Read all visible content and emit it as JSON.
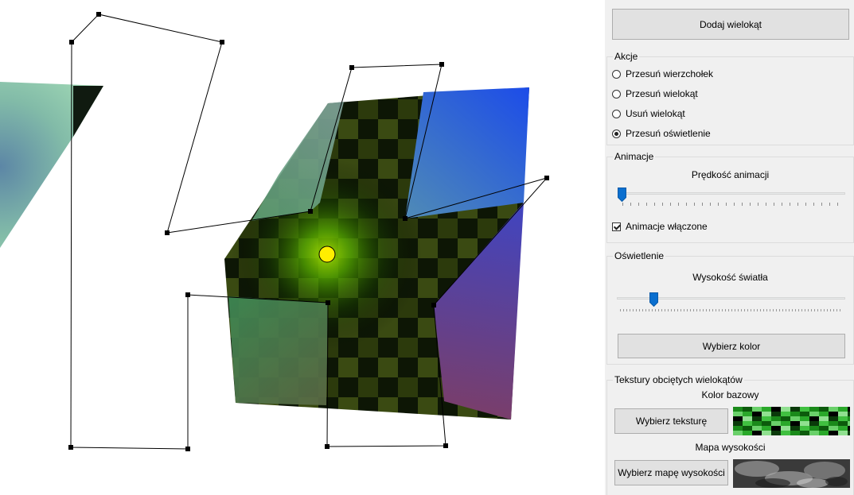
{
  "add_polygon_label": "Dodaj wielokąt",
  "actions": {
    "title": "Akcje",
    "options": [
      {
        "label": "Przesuń wierzchołek",
        "selected": false
      },
      {
        "label": "Przesuń wielokąt",
        "selected": false
      },
      {
        "label": "Usuń wielokąt",
        "selected": false
      },
      {
        "label": "Przesuń oświetlenie",
        "selected": true
      }
    ]
  },
  "animation": {
    "title": "Animacje",
    "speed_label": "Prędkość animacji",
    "speed_value": 0.0,
    "enabled_label": "Animacje włączone",
    "enabled": true
  },
  "lighting": {
    "title": "Oświetlenie",
    "height_label": "Wysokość światła",
    "height_value": 0.15,
    "color_button": "Wybierz kolor"
  },
  "textures": {
    "title": "Tekstury obciętych wielokątów",
    "base_color_label": "Kolor bazowy",
    "choose_texture_button": "Wybierz teksturę",
    "height_map_label": "Mapa wysokości",
    "choose_height_map_button": "Wybierz mapę wysokości"
  },
  "colors": {
    "accent": "#0a6fcf",
    "light_source": "#ffee00"
  }
}
